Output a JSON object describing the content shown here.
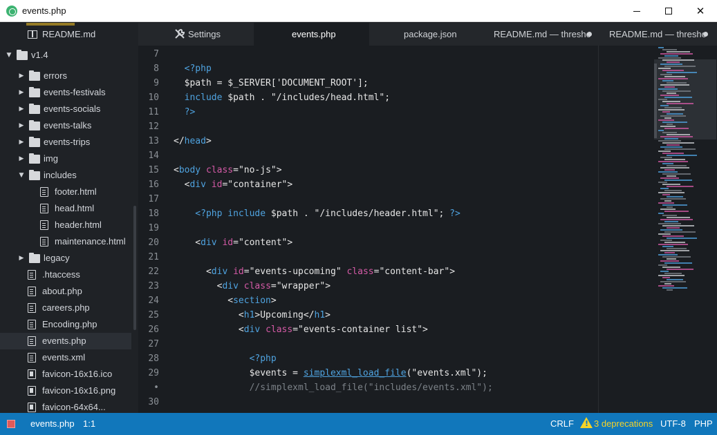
{
  "window": {
    "title": "events.php"
  },
  "sidebar": {
    "items": [
      {
        "label": "README.md",
        "type": "readme",
        "depth": 1
      },
      {
        "label": "v1.4",
        "type": "folder",
        "open": true,
        "depth": 0
      },
      {
        "label": "errors",
        "type": "folder",
        "depth": 1
      },
      {
        "label": "events-festivals",
        "type": "folder",
        "depth": 1
      },
      {
        "label": "events-socials",
        "type": "folder",
        "depth": 1
      },
      {
        "label": "events-talks",
        "type": "folder",
        "depth": 1
      },
      {
        "label": "events-trips",
        "type": "folder",
        "depth": 1
      },
      {
        "label": "img",
        "type": "folder",
        "depth": 1
      },
      {
        "label": "includes",
        "type": "folder",
        "open": true,
        "depth": 1
      },
      {
        "label": "footer.html",
        "type": "file",
        "depth": 2
      },
      {
        "label": "head.html",
        "type": "file",
        "depth": 2
      },
      {
        "label": "header.html",
        "type": "file",
        "depth": 2
      },
      {
        "label": "maintenance.html",
        "type": "file",
        "depth": 2
      },
      {
        "label": "legacy",
        "type": "folder",
        "depth": 1
      },
      {
        "label": ".htaccess",
        "type": "file",
        "depth": 1
      },
      {
        "label": "about.php",
        "type": "file",
        "depth": 1
      },
      {
        "label": "careers.php",
        "type": "file",
        "depth": 1
      },
      {
        "label": "Encoding.php",
        "type": "file",
        "depth": 1
      },
      {
        "label": "events.php",
        "type": "file",
        "depth": 1,
        "active": true
      },
      {
        "label": "events.xml",
        "type": "file",
        "depth": 1
      },
      {
        "label": "favicon-16x16.ico",
        "type": "image",
        "depth": 1
      },
      {
        "label": "favicon-16x16.png",
        "type": "image",
        "depth": 1
      },
      {
        "label": "favicon-64x64...",
        "type": "image",
        "depth": 1
      }
    ]
  },
  "tabs": [
    {
      "label": "Settings",
      "icon": "wrench-icon"
    },
    {
      "label": "events.php",
      "active": true
    },
    {
      "label": "package.json"
    },
    {
      "label": "README.md — thresho",
      "modified": true
    },
    {
      "label": "README.md — thresho",
      "modified": true
    }
  ],
  "editor": {
    "lines": [
      {
        "num": "7",
        "tokens": []
      },
      {
        "num": "8",
        "tokens": [
          [
            "php",
            "  <?php"
          ]
        ]
      },
      {
        "num": "9",
        "tokens": [
          [
            "pl",
            "  $path = $_SERVER['DOCUMENT_ROOT'];"
          ]
        ]
      },
      {
        "num": "10",
        "tokens": [
          [
            "php",
            "  include "
          ],
          [
            "pl",
            "$path . \"/includes/head.html\";"
          ]
        ]
      },
      {
        "num": "11",
        "tokens": [
          [
            "php",
            "  ?>"
          ]
        ]
      },
      {
        "num": "12",
        "tokens": []
      },
      {
        "num": "13",
        "tokens": [
          [
            "tag",
            "</"
          ],
          [
            "el",
            "head"
          ],
          [
            "tag",
            ">"
          ]
        ]
      },
      {
        "num": "14",
        "tokens": []
      },
      {
        "num": "15",
        "tokens": [
          [
            "tag",
            "<"
          ],
          [
            "el",
            "body "
          ],
          [
            "attr",
            "class"
          ],
          [
            "tag",
            "="
          ],
          [
            "str",
            "\"no-js\""
          ],
          [
            "tag",
            ">"
          ]
        ]
      },
      {
        "num": "16",
        "tokens": [
          [
            "tag",
            "  <"
          ],
          [
            "el",
            "div "
          ],
          [
            "attr",
            "id"
          ],
          [
            "tag",
            "="
          ],
          [
            "str",
            "\"container\""
          ],
          [
            "tag",
            ">"
          ]
        ]
      },
      {
        "num": "17",
        "tokens": []
      },
      {
        "num": "18",
        "tokens": [
          [
            "php",
            "    <?php include "
          ],
          [
            "pl",
            "$path . \"/includes/header.html\"; "
          ],
          [
            "php",
            "?>"
          ]
        ]
      },
      {
        "num": "19",
        "tokens": []
      },
      {
        "num": "20",
        "tokens": [
          [
            "tag",
            "    <"
          ],
          [
            "el",
            "div "
          ],
          [
            "attr",
            "id"
          ],
          [
            "tag",
            "="
          ],
          [
            "str",
            "\"content\""
          ],
          [
            "tag",
            ">"
          ]
        ]
      },
      {
        "num": "21",
        "tokens": []
      },
      {
        "num": "22",
        "tokens": [
          [
            "tag",
            "      <"
          ],
          [
            "el",
            "div "
          ],
          [
            "attr",
            "id"
          ],
          [
            "tag",
            "="
          ],
          [
            "str",
            "\"events-upcoming\" "
          ],
          [
            "attr",
            "class"
          ],
          [
            "tag",
            "="
          ],
          [
            "str",
            "\"content-bar\""
          ],
          [
            "tag",
            ">"
          ]
        ]
      },
      {
        "num": "23",
        "tokens": [
          [
            "tag",
            "        <"
          ],
          [
            "el",
            "div "
          ],
          [
            "attr",
            "class"
          ],
          [
            "tag",
            "="
          ],
          [
            "str",
            "\"wrapper\""
          ],
          [
            "tag",
            ">"
          ]
        ]
      },
      {
        "num": "24",
        "tokens": [
          [
            "tag",
            "          <"
          ],
          [
            "el",
            "section"
          ],
          [
            "tag",
            ">"
          ]
        ]
      },
      {
        "num": "25",
        "tokens": [
          [
            "tag",
            "            <"
          ],
          [
            "el",
            "h1"
          ],
          [
            "tag",
            ">"
          ],
          [
            "pl",
            "Upcoming"
          ],
          [
            "tag",
            "</"
          ],
          [
            "el",
            "h1"
          ],
          [
            "tag",
            ">"
          ]
        ]
      },
      {
        "num": "26",
        "tokens": [
          [
            "tag",
            "            <"
          ],
          [
            "el",
            "div "
          ],
          [
            "attr",
            "class"
          ],
          [
            "tag",
            "="
          ],
          [
            "str",
            "\"events-container list\""
          ],
          [
            "tag",
            ">"
          ]
        ]
      },
      {
        "num": "27",
        "tokens": []
      },
      {
        "num": "28",
        "tokens": [
          [
            "php",
            "              <?php"
          ]
        ]
      },
      {
        "num": "29",
        "tokens": [
          [
            "pl",
            "              $events = "
          ],
          [
            "fn",
            "simplexml_load_file"
          ],
          [
            "pl",
            "(\"events.xml\");"
          ]
        ]
      },
      {
        "num": "•",
        "tokens": [
          [
            "cmt",
            "              //simplexml_load_file(\"includes/events.xml\");"
          ]
        ]
      },
      {
        "num": "30",
        "tokens": []
      }
    ]
  },
  "statusbar": {
    "file": "events.php",
    "cursor": "1:1",
    "line_ending": "CRLF",
    "deprecations": "3 deprecations",
    "encoding": "UTF-8",
    "grammar": "PHP",
    "accent": "#1177bb"
  }
}
